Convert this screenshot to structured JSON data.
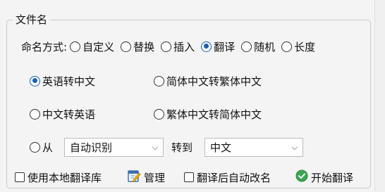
{
  "group": {
    "title": "文件名"
  },
  "naming": {
    "label": "命名方式:",
    "options": [
      {
        "label": "自定义",
        "selected": false
      },
      {
        "label": "替换",
        "selected": false
      },
      {
        "label": "插入",
        "selected": false
      },
      {
        "label": "翻译",
        "selected": true
      },
      {
        "label": "随机",
        "selected": false
      },
      {
        "label": "长度",
        "selected": false
      }
    ]
  },
  "translate_modes": [
    {
      "label": "英语转中文",
      "selected": true
    },
    {
      "label": "简体中文转繁体中文",
      "selected": false
    },
    {
      "label": "中文转英语",
      "selected": false
    },
    {
      "label": "繁体中文转简体中文",
      "selected": false
    }
  ],
  "custom": {
    "from_label": "从",
    "from_value": "自动识别",
    "to_label": "转到",
    "to_value": "中文",
    "selected": false
  },
  "footer": {
    "use_local_library": "使用本地翻译库",
    "use_local_checked": false,
    "manage": "管理",
    "auto_rename": "翻译后自动改名",
    "auto_rename_checked": false,
    "start": "开始翻译"
  },
  "colors": {
    "accent": "#1a5fb4",
    "success": "#3aa655",
    "border": "#c8c8c8"
  }
}
